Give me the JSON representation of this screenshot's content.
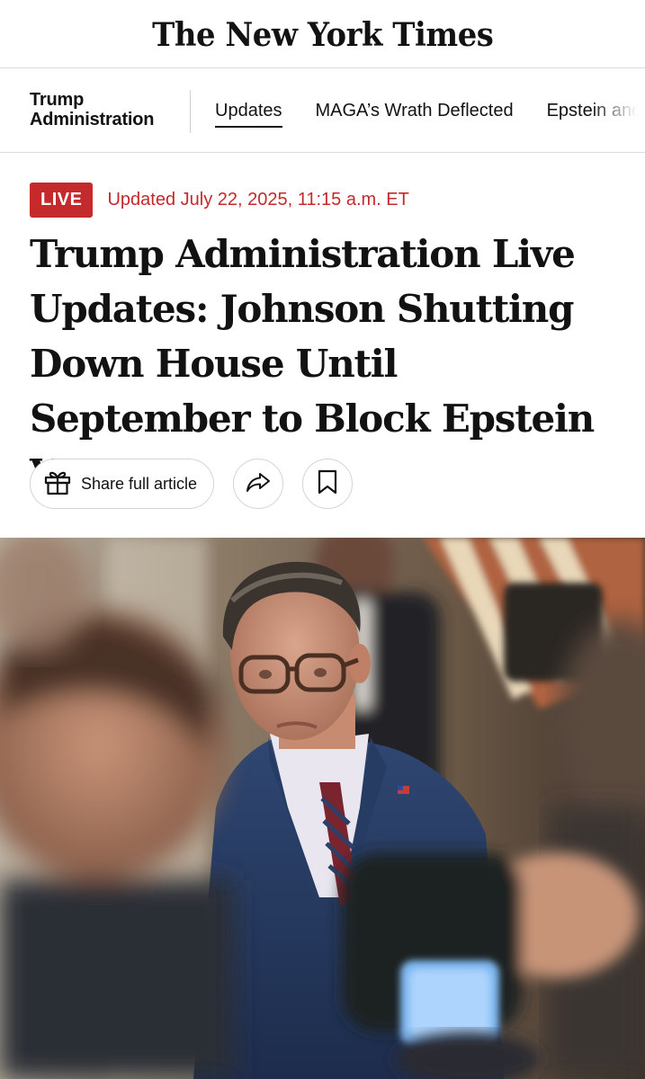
{
  "masthead": {
    "logo": "The New York Times"
  },
  "section_nav": {
    "title_line1": "Trump",
    "title_line2": "Administration",
    "links": [
      {
        "label": "Updates",
        "active": true
      },
      {
        "label": "MAGA’s Wrath Deflected",
        "active": false
      },
      {
        "label": "Epstein and",
        "active": false
      }
    ]
  },
  "article": {
    "live_badge": "LIVE",
    "updated": "Updated July 22, 2025, 11:15 a.m. ET",
    "headline": "Trump Administration Live Updates: Johnson Shutting Down House Until September to Block Epstein Vote",
    "share_label": "Share full article"
  },
  "icons": {
    "share": "gift-icon",
    "forward": "share-arrow-icon",
    "save": "bookmark-icon"
  },
  "colors": {
    "live_red": "#c42a2b",
    "text": "#121212",
    "divider": "#dcdcdc"
  }
}
